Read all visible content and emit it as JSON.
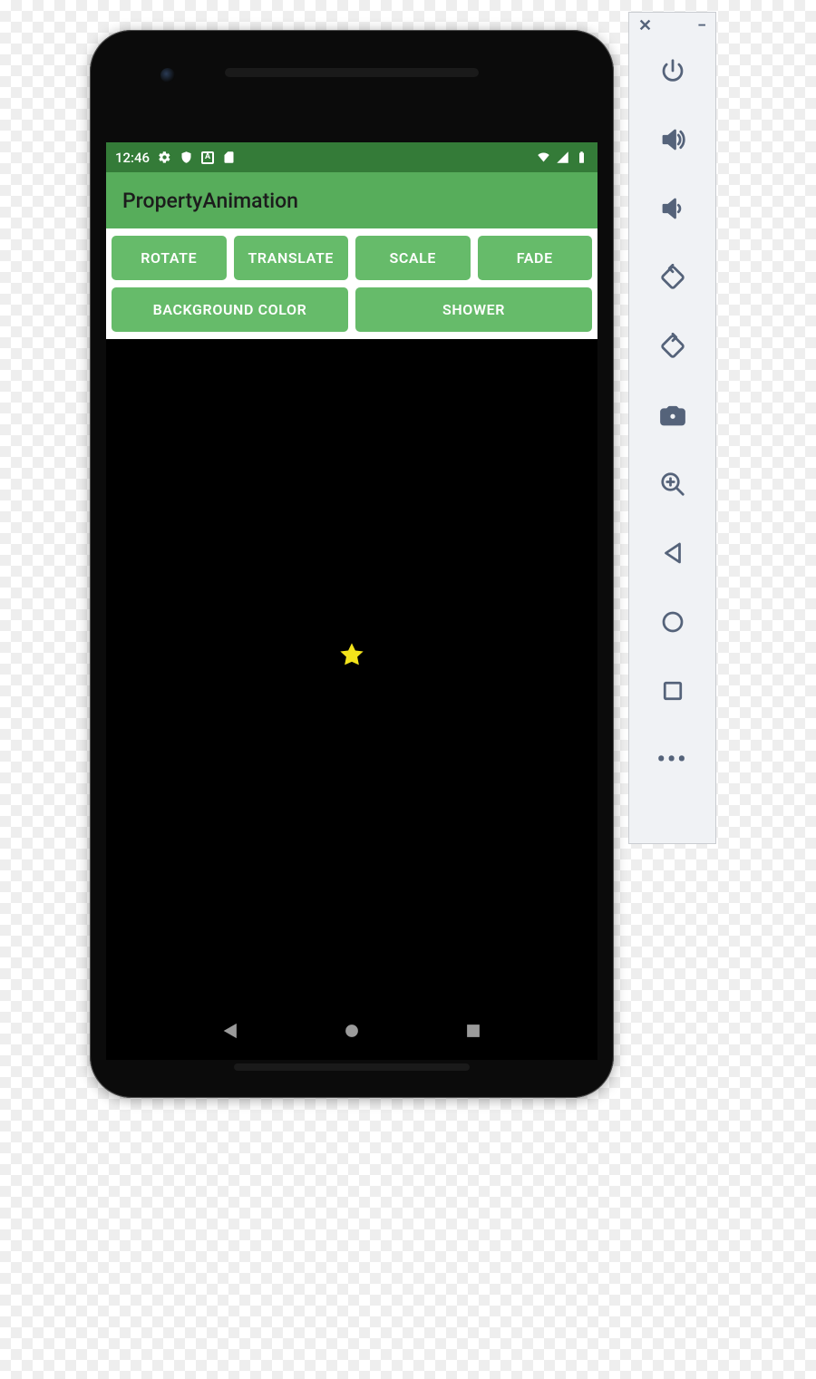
{
  "statusbar": {
    "time": "12:46"
  },
  "app": {
    "title": "PropertyAnimation"
  },
  "buttons": {
    "rotate": "ROTATE",
    "translate": "TRANSLATE",
    "scale": "SCALE",
    "fade": "FADE",
    "bgcolor": "BACKGROUND COLOR",
    "shower": "SHOWER"
  },
  "star": {
    "color": "#f3e31b"
  },
  "toolbar": {
    "items": [
      {
        "name": "power"
      },
      {
        "name": "volume-up"
      },
      {
        "name": "volume-down"
      },
      {
        "name": "rotate-left"
      },
      {
        "name": "rotate-right"
      },
      {
        "name": "camera"
      },
      {
        "name": "zoom"
      },
      {
        "name": "back"
      },
      {
        "name": "home"
      },
      {
        "name": "overview"
      },
      {
        "name": "more"
      }
    ]
  }
}
